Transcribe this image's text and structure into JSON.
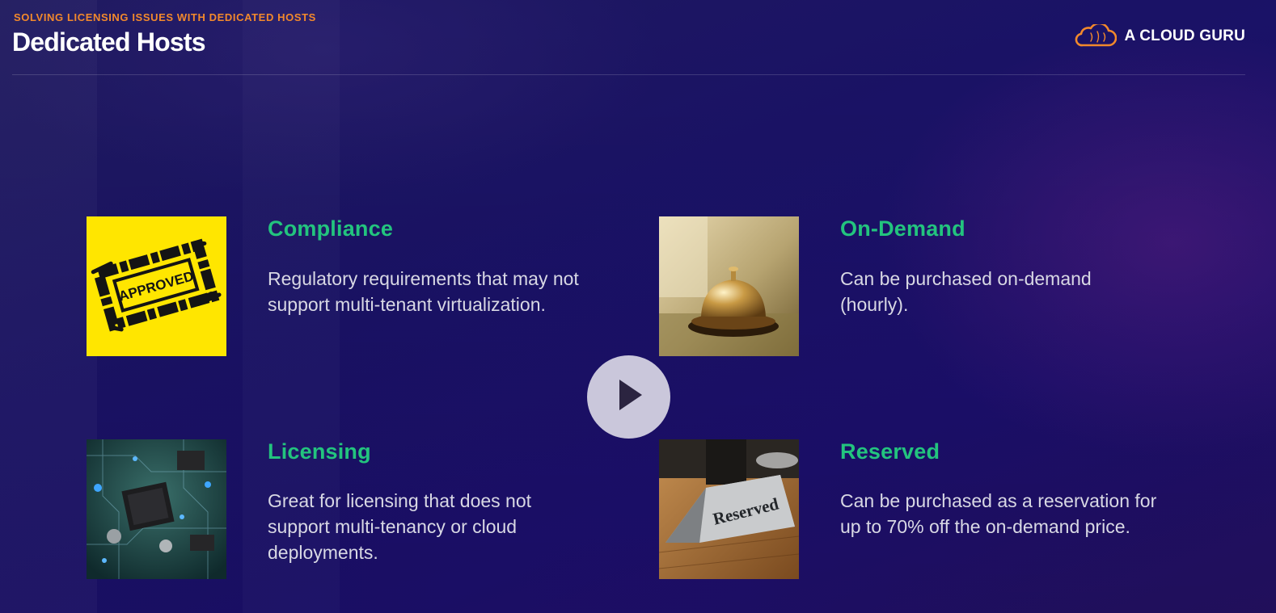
{
  "header": {
    "kicker": "SOLVING LICENSING ISSUES WITH DEDICATED HOSTS",
    "title": "Dedicated Hosts"
  },
  "brand": {
    "name": "A CLOUD GURU",
    "icon": "cloud-logo-icon",
    "accent": "#f2892c"
  },
  "features": [
    {
      "title": "Compliance",
      "description": "Regulatory requirements that may not support multi-tenant virtualization.",
      "image": "approved-stamp-image",
      "image_text": "APPROVED"
    },
    {
      "title": "On-Demand",
      "description": "Can be purchased on-demand (hourly).",
      "image": "service-bell-image"
    },
    {
      "title": "Licensing",
      "description": "Great for licensing that does not support multi-tenancy or cloud deployments.",
      "image": "circuit-board-image"
    },
    {
      "title": "Reserved",
      "description": "Can be purchased as a reservation for up to 70% off the on-demand price.",
      "image": "reserved-sign-image",
      "image_text": "Reserved"
    }
  ],
  "player": {
    "control": "play-icon"
  },
  "colors": {
    "heading_green": "#23c47e",
    "kicker_orange": "#f2892c",
    "background": "#1b1464"
  }
}
